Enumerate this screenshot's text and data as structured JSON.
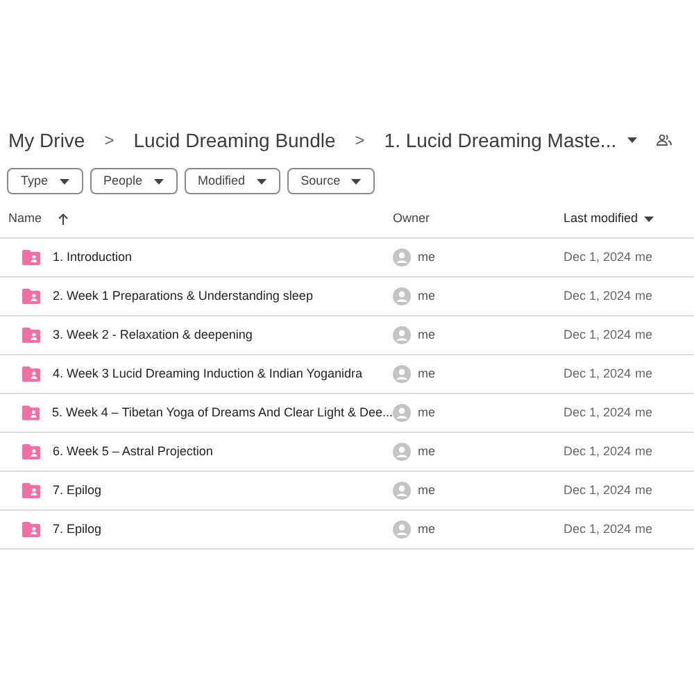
{
  "breadcrumb": {
    "items": [
      "My Drive",
      "Lucid Dreaming Bundle",
      "1. Lucid Dreaming Maste..."
    ],
    "separator": ">"
  },
  "filters": [
    "Type",
    "People",
    "Modified",
    "Source"
  ],
  "table": {
    "columns": [
      "Name",
      "Owner",
      "Last modified"
    ],
    "rows": [
      {
        "name": "1. Introduction",
        "owner": "me",
        "modified": "Dec 1, 2024",
        "modified_by": "me"
      },
      {
        "name": "2. Week 1 Preparations & Understanding sleep",
        "owner": "me",
        "modified": "Dec 1, 2024",
        "modified_by": "me"
      },
      {
        "name": "3. Week 2 - Relaxation & deepening",
        "owner": "me",
        "modified": "Dec 1, 2024",
        "modified_by": "me"
      },
      {
        "name": "4. Week 3 Lucid Dreaming Induction & Indian Yoganidra",
        "owner": "me",
        "modified": "Dec 1, 2024",
        "modified_by": "me"
      },
      {
        "name": "5. Week 4 – Tibetan Yoga of Dreams And Clear Light & Dee...",
        "owner": "me",
        "modified": "Dec 1, 2024",
        "modified_by": "me"
      },
      {
        "name": "6. Week 5 – Astral Projection",
        "owner": "me",
        "modified": "Dec 1, 2024",
        "modified_by": "me"
      },
      {
        "name": "7. Epilog",
        "owner": "me",
        "modified": "Dec 1, 2024",
        "modified_by": "me"
      },
      {
        "name": "7. Epilog",
        "owner": "me",
        "modified": "Dec 1, 2024",
        "modified_by": "me"
      }
    ]
  }
}
